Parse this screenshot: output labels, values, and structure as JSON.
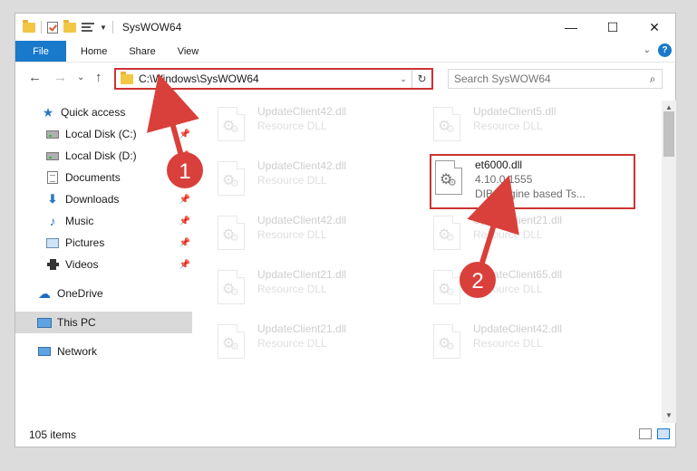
{
  "window": {
    "title": "SysWOW64",
    "minimize": "—",
    "maximize": "☐",
    "close": "✕"
  },
  "ribbon": {
    "tabs": [
      "File",
      "Home",
      "Share",
      "View"
    ],
    "help": "?",
    "collapse": "⌄"
  },
  "address": {
    "path": "C:\\Windows\\SysWOW64",
    "back": "←",
    "forward": "→",
    "recent": "⌄",
    "up": "↑",
    "dropdown": "⌄",
    "refresh": "↻"
  },
  "search": {
    "placeholder": "Search SysWOW64",
    "icon": "⌕"
  },
  "nav": {
    "items": [
      {
        "label": "Quick access",
        "icon": "star-icon",
        "pinned": false
      },
      {
        "label": "Local Disk (C:)",
        "icon": "disk-icon",
        "pinned": true
      },
      {
        "label": "Local Disk (D:)",
        "icon": "disk-icon",
        "pinned": true
      },
      {
        "label": "Documents",
        "icon": "documents-icon",
        "pinned": true
      },
      {
        "label": "Downloads",
        "icon": "downloads-icon",
        "pinned": true
      },
      {
        "label": "Music",
        "icon": "music-icon",
        "pinned": true
      },
      {
        "label": "Pictures",
        "icon": "pictures-icon",
        "pinned": true
      },
      {
        "label": "Videos",
        "icon": "videos-icon",
        "pinned": true
      },
      {
        "label": "OneDrive",
        "icon": "onedrive-icon",
        "pinned": false
      },
      {
        "label": "This PC",
        "icon": "computer-icon",
        "pinned": false,
        "selected": true
      },
      {
        "label": "Network",
        "icon": "network-icon",
        "pinned": false
      }
    ]
  },
  "files": {
    "left_column": [
      {
        "name": "UpdateClient42.dll",
        "desc": "Resource DLL"
      },
      {
        "name": "UpdateClient42.dll",
        "desc": "Resource DLL"
      },
      {
        "name": "UpdateClient42.dll",
        "desc": "Resource DLL"
      },
      {
        "name": "UpdateClient21.dll",
        "desc": "Resource DLL"
      },
      {
        "name": "UpdateClient21.dll",
        "desc": "Resource DLL"
      }
    ],
    "right_column": [
      {
        "name": "UpdateClient5.dll",
        "desc": "Resource DLL"
      },
      {
        "name": "et6000.dll",
        "version": "4.10.0.1555",
        "desc": "DIB Engine based Ts..."
      },
      {
        "name": "UpdateClient21.dll",
        "desc": "Resource DLL"
      },
      {
        "name": "UpdateClient65.dll",
        "desc": "Resource DLL"
      },
      {
        "name": "UpdateClient42.dll",
        "desc": "Resource DLL"
      }
    ]
  },
  "status": {
    "item_count": "105 items"
  },
  "annotations": {
    "step1": "1",
    "step2": "2",
    "highlight_color": "#cc3333",
    "badge_color": "#d9403b"
  },
  "colors": {
    "accent": "#1979ca"
  }
}
